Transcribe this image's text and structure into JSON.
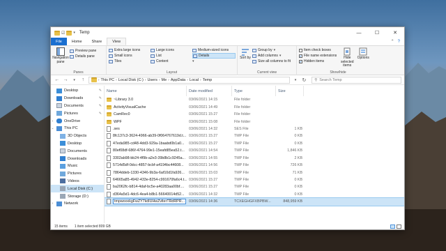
{
  "window": {
    "title": "Temp"
  },
  "ribbon_tabs": [
    {
      "label": "File"
    },
    {
      "label": "Home"
    },
    {
      "label": "Share"
    },
    {
      "label": "View"
    }
  ],
  "ribbon": {
    "panes": {
      "label": "Panes",
      "navigation_pane": "Navigation pane",
      "preview_pane": "Preview pane",
      "details_pane": "Details pane"
    },
    "layout": {
      "label": "Layout",
      "items": [
        "Extra large icons",
        "Large icons",
        "Medium-sized icons",
        "Small icons",
        "List",
        "Details",
        "Tiles",
        "Content",
        ""
      ],
      "selected": "Details"
    },
    "current_view": {
      "label": "Current view",
      "sort_by": "Sort by",
      "group_by": "Group by",
      "add_columns": "Add columns",
      "size_all": "Size all columns to fit"
    },
    "show_hide": {
      "label": "Show/hide",
      "item_check_boxes": "Item check boxes",
      "file_name_extensions": "File name extensions",
      "hidden_items": "Hidden items",
      "hide_selected": "Hide selected items",
      "options": "Options"
    }
  },
  "address": {
    "crumbs": [
      "This PC",
      "Local Disk (C:)",
      "Users",
      "Me",
      "AppData",
      "Local",
      "Temp"
    ],
    "search_placeholder": "Search Temp"
  },
  "nav": [
    {
      "label": "Desktop",
      "pinned": true
    },
    {
      "label": "Downloads",
      "pinned": true
    },
    {
      "label": "Documents",
      "pinned": true
    },
    {
      "label": "Pictures",
      "pinned": true
    },
    {
      "label": "OneDrive",
      "pinned": false
    },
    {
      "label": "This PC",
      "pinned": false
    },
    {
      "label": "3D Objects",
      "pinned": false
    },
    {
      "label": "Desktop",
      "pinned": false
    },
    {
      "label": "Documents",
      "pinned": false
    },
    {
      "label": "Downloads",
      "pinned": false
    },
    {
      "label": "Music",
      "pinned": false
    },
    {
      "label": "Pictures",
      "pinned": false
    },
    {
      "label": "Videos",
      "pinned": false
    },
    {
      "label": "Local Disk (C:)",
      "pinned": false
    },
    {
      "label": "Storage (D:)",
      "pinned": false
    },
    {
      "label": "Network",
      "pinned": false
    }
  ],
  "columns": {
    "name": "Name",
    "date": "Date modified",
    "type": "Type",
    "size": "Size"
  },
  "files": [
    {
      "name": "~Library 3.0",
      "date": "03/06/2021 14:15",
      "type": "File folder",
      "size": "",
      "kind": "folder"
    },
    {
      "name": "ActivityVisualCache",
      "date": "03/06/2021 14:49",
      "type": "File folder",
      "size": "",
      "kind": "folder"
    },
    {
      "name": "CamRec0",
      "date": "03/06/2021 15:27",
      "type": "File folder",
      "size": "",
      "kind": "folder"
    },
    {
      "name": "WPF",
      "date": "03/06/2021 15:08",
      "type": "File folder",
      "size": "",
      "kind": "folder"
    },
    {
      "name": ".ses",
      "date": "03/06/2021 14:32",
      "type": "SES File",
      "size": "1 KB",
      "kind": "file"
    },
    {
      "name": "8fc137c3-3624-4966-ab39-0f064767619d.t...",
      "date": "03/06/2021 15:27",
      "type": "TMP File",
      "size": "0 KB",
      "kind": "file"
    },
    {
      "name": "47eda985-cd48-4dd3-929a-1baabd0b1a0...",
      "date": "03/06/2021 15:27",
      "type": "TMP File",
      "size": "0 KB",
      "kind": "file"
    },
    {
      "name": "80ef08df-686f-4764-99e1-15eafd85ea52.t...",
      "date": "03/06/2021 14:54",
      "type": "TMP File",
      "size": "1,846 KB",
      "kind": "file"
    },
    {
      "name": "3302ab98-bb24-4f9b-a2e3-39b8b1c9245a...",
      "date": "03/06/2021 14:55",
      "type": "TMP File",
      "size": "2 KB",
      "kind": "file"
    },
    {
      "name": "5714d5df-0dcc-4857-bcbf-a4194bc44608...",
      "date": "03/06/2021 14:56",
      "type": "TMP File",
      "size": "726 KB",
      "kind": "file"
    },
    {
      "name": "7864ddeb-1330-4346-9b3a-6af10d1fa926...",
      "date": "03/06/2021 15:03",
      "type": "TMP File",
      "size": "71 KB",
      "kind": "file"
    },
    {
      "name": "64665a85-4942-433e-8254-c991670fa6c4.t...",
      "date": "03/06/2021 15:27",
      "type": "TMP File",
      "size": "0 KB",
      "kind": "file"
    },
    {
      "name": "ba2062fc-b814-4daf-bc5e-a40283aa00bf....",
      "date": "03/06/2021 15:27",
      "type": "TMP File",
      "size": "0 KB",
      "kind": "file"
    },
    {
      "name": "d364a5d1-4dc6-4ea4-b8b1-56640014d52...",
      "date": "03/06/2021 14:32",
      "type": "TMP File",
      "size": "0 KB",
      "kind": "file"
    },
    {
      "name": "tmpwooxkgFwZY7kdIUHwZvlterTRdRPR...",
      "date": "03/06/2021 14:36",
      "type": "TCXEGHGFXBPBW...",
      "size": "848,959 KB",
      "kind": "file",
      "selected": true
    }
  ],
  "status": {
    "count": "15 items",
    "selection": "1 item selected  809 GB"
  },
  "colors": {
    "accent": "#1a6fd0",
    "selection": "#cce4f7",
    "folder": "#e8c14a"
  }
}
